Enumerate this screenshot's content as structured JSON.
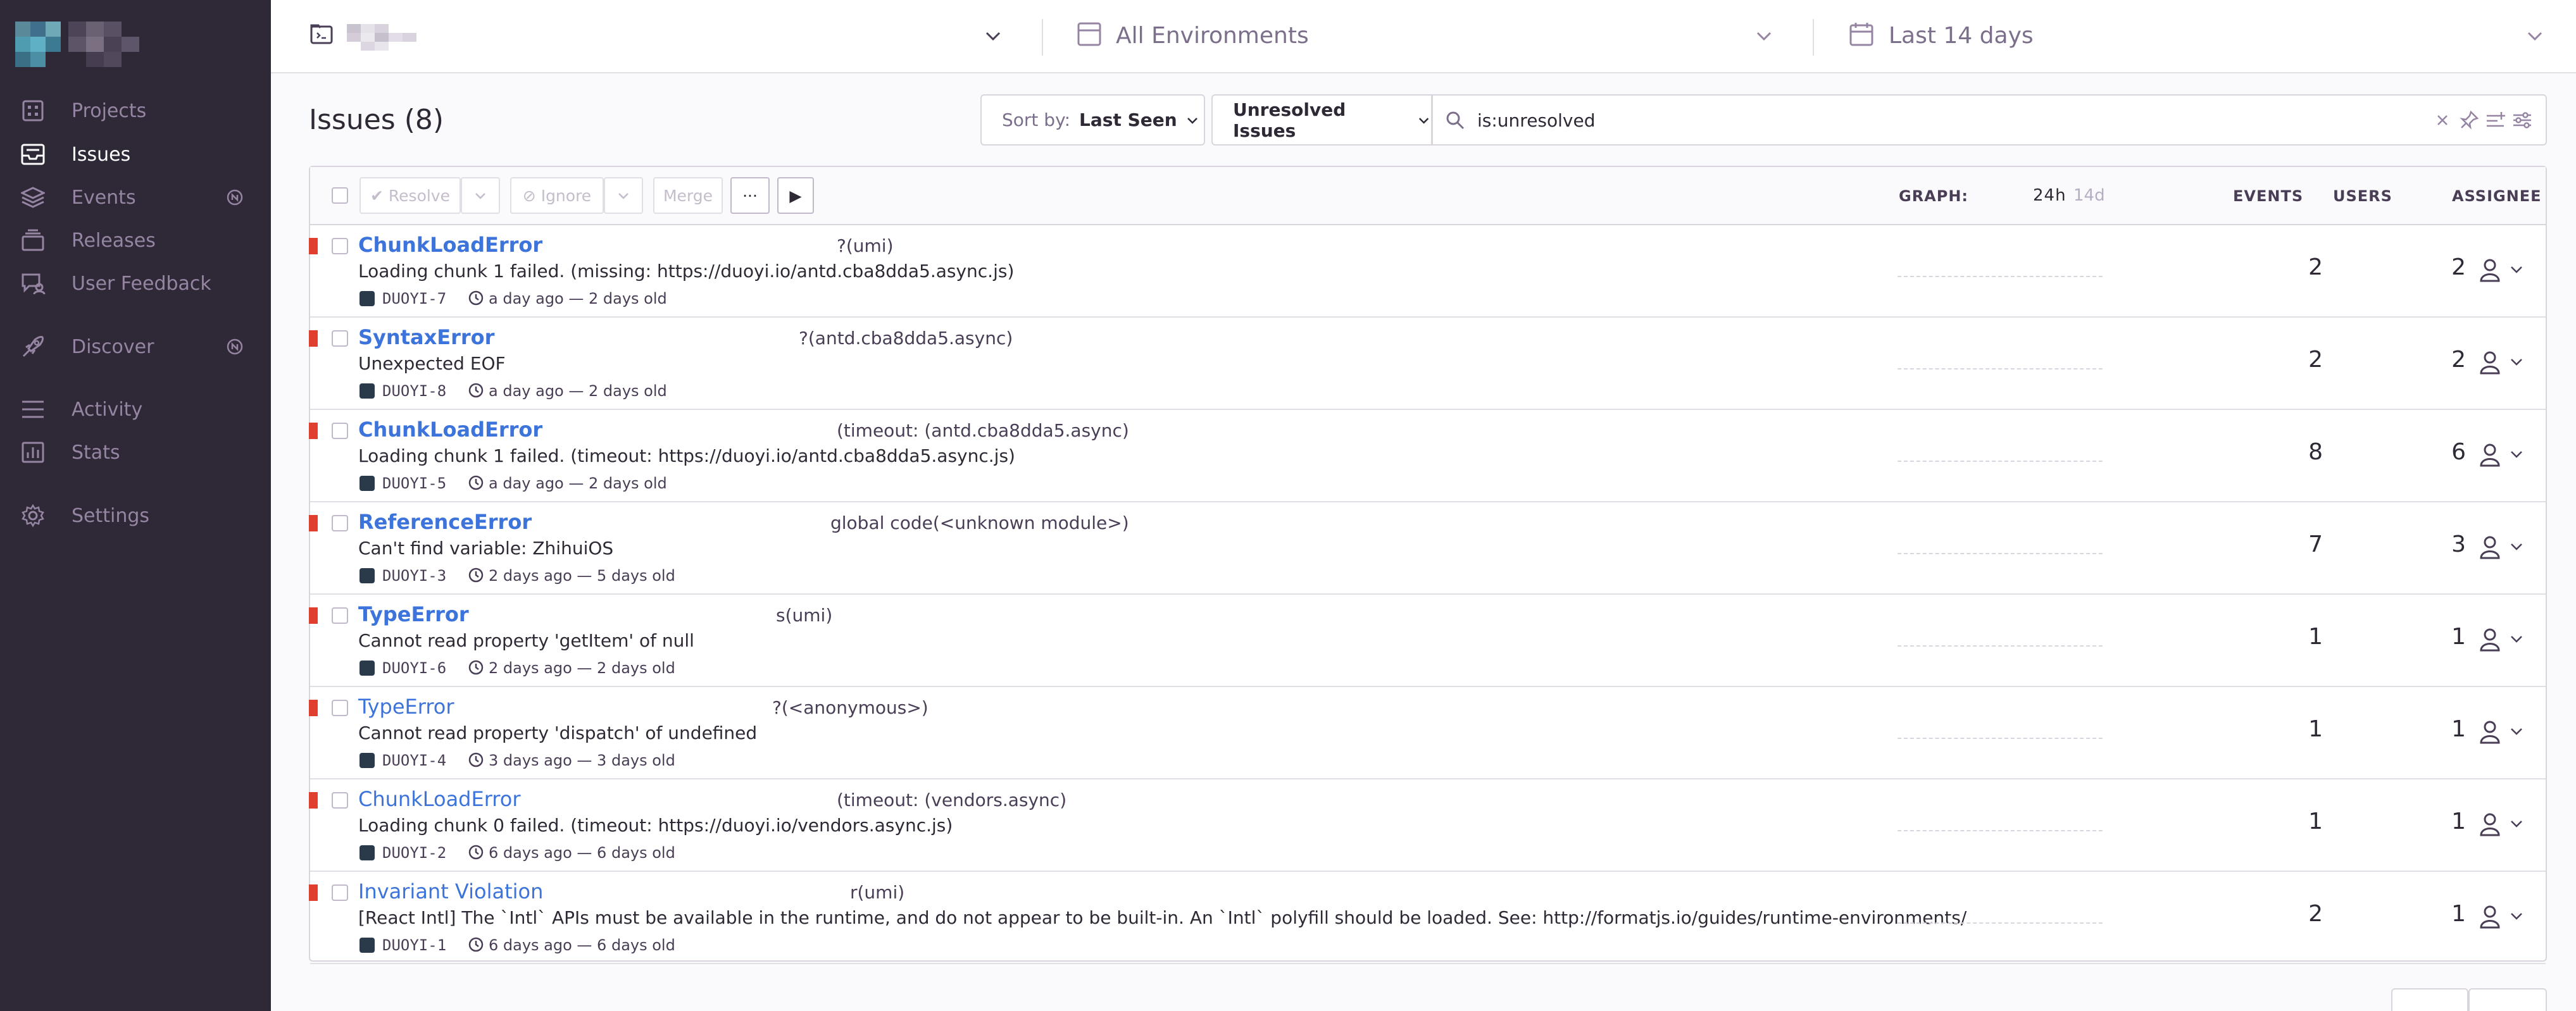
{
  "sidebar": {
    "items": [
      {
        "label": "Projects",
        "icon": "projects-icon"
      },
      {
        "label": "Issues",
        "icon": "issues-icon"
      },
      {
        "label": "Events",
        "icon": "events-icon"
      },
      {
        "label": "Releases",
        "icon": "releases-icon"
      },
      {
        "label": "User Feedback",
        "icon": "user-feedback-icon"
      },
      {
        "label": "Discover",
        "icon": "discover-icon"
      },
      {
        "label": "Activity",
        "icon": "activity-icon"
      },
      {
        "label": "Stats",
        "icon": "stats-icon"
      },
      {
        "label": "Settings",
        "icon": "settings-icon"
      }
    ],
    "active": "Issues"
  },
  "topbar": {
    "environment_label": "All Environments",
    "period_label": "Last 14 days"
  },
  "header": {
    "title": "Issues (8)",
    "sort_prefix": "Sort by:",
    "sort_value": "Last Seen",
    "saved_search": "Unresolved Issues",
    "query": "is:unresolved"
  },
  "toolbar": {
    "resolve_label": "✔ Resolve",
    "ignore_label": "⊘ Ignore",
    "merge_label": "Merge",
    "more_label": "···",
    "play_label": "▶"
  },
  "columns": {
    "graph": "GRAPH:",
    "graph_24h": "24h",
    "graph_14d": "14d",
    "events": "EVENTS",
    "users": "USERS",
    "assignee": "ASSIGNEE"
  },
  "issues": [
    {
      "type": "ChunkLoadError",
      "culprit": "?(umi)",
      "message": "Loading chunk 1 failed. (missing: https://duoyi.io/antd.cba8dda5.async.js)",
      "short_id": "DUOYI-7",
      "age": "a day ago — 2 days old",
      "events": "2",
      "users": "2",
      "bold": true
    },
    {
      "type": "SyntaxError",
      "culprit": "?(antd.cba8dda5.async)",
      "message": "Unexpected EOF",
      "short_id": "DUOYI-8",
      "age": "a day ago — 2 days old",
      "events": "2",
      "users": "2",
      "bold": true
    },
    {
      "type": "ChunkLoadError",
      "culprit": "(timeout: (antd.cba8dda5.async)",
      "message": "Loading chunk 1 failed. (timeout: https://duoyi.io/antd.cba8dda5.async.js)",
      "short_id": "DUOYI-5",
      "age": "a day ago — 2 days old",
      "events": "8",
      "users": "6",
      "bold": true
    },
    {
      "type": "ReferenceError",
      "culprit": "global code(<unknown module>)",
      "message": "Can't find variable: ZhihuiOS",
      "short_id": "DUOYI-3",
      "age": "2 days ago — 5 days old",
      "events": "7",
      "users": "3",
      "bold": true
    },
    {
      "type": "TypeError",
      "culprit": "s(umi)",
      "message": "Cannot read property 'getItem' of null",
      "short_id": "DUOYI-6",
      "age": "2 days ago — 2 days old",
      "events": "1",
      "users": "1",
      "bold": true
    },
    {
      "type": "TypeError",
      "culprit": "?(<anonymous>)",
      "message": "Cannot read property 'dispatch' of undefined",
      "short_id": "DUOYI-4",
      "age": "3 days ago — 3 days old",
      "events": "1",
      "users": "1",
      "bold": false
    },
    {
      "type": "ChunkLoadError",
      "culprit": "(timeout: (vendors.async)",
      "message": "Loading chunk 0 failed. (timeout: https://duoyi.io/vendors.async.js)",
      "short_id": "DUOYI-2",
      "age": "6 days ago — 6 days old",
      "events": "1",
      "users": "1",
      "bold": false
    },
    {
      "type": "Invariant Violation",
      "culprit": "r(umi)",
      "message": "[React Intl] The `Intl` APIs must be available in the runtime, and do not appear to be built-in. An `Intl` polyfill should be loaded. See: http://formatjs.io/guides/runtime-environments/",
      "short_id": "DUOYI-1",
      "age": "6 days ago — 6 days old",
      "events": "2",
      "users": "1",
      "bold": false
    }
  ],
  "colors": {
    "sidebar_bg": "#2f2937",
    "link": "#3d74db",
    "level_error": "#e03e2f"
  }
}
